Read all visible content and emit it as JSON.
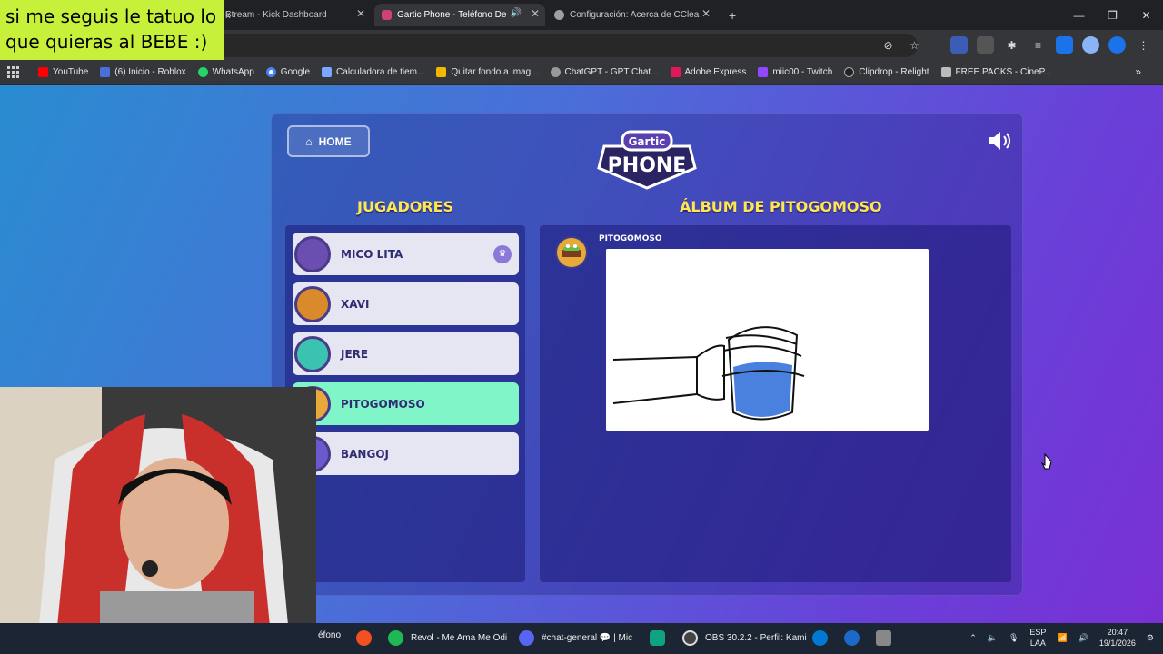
{
  "overlay": {
    "text": "si me seguis le tatuo lo que quieras al BEBE :)"
  },
  "browser": {
    "tabs": [
      {
        "title": "Stream - Kick Dashboard",
        "color": "#53fc18"
      },
      {
        "title": "Gartic Phone - Teléfono De",
        "color": "#8e44ff"
      },
      {
        "title": "Configuración: Acerca de CClea",
        "color": "#888888"
      }
    ],
    "omnibox_text": "k",
    "bookmarks": [
      {
        "label": "YouTube",
        "color": "#ff0000"
      },
      {
        "label": "(6) Inicio - Roblox",
        "color": "#4a6fd8"
      },
      {
        "label": "WhatsApp",
        "color": "#25d366"
      },
      {
        "label": "Google",
        "color": "#4285f4"
      },
      {
        "label": "Calculadora de tiem...",
        "color": "#7aa7ff"
      },
      {
        "label": "Quitar fondo a imag...",
        "color": "#f5b800"
      },
      {
        "label": "ChatGPT - GPT Chat...",
        "color": "#999999"
      },
      {
        "label": "Adobe Express",
        "color": "#e0185a"
      },
      {
        "label": "miic00 - Twitch",
        "color": "#9146ff"
      },
      {
        "label": "Clipdrop - Relight",
        "color": "#222222"
      },
      {
        "label": "FREE PACKS - CineP...",
        "color": "#bbbbbb"
      }
    ]
  },
  "game": {
    "home_label": "HOME",
    "players_title": "JUGADORES",
    "album_title": "ÁLBUM DE PITOGOMOSO",
    "players": [
      {
        "name": "MICO LITA",
        "host": true,
        "avatar_color": "#6b4fb0"
      },
      {
        "name": "XAVI",
        "host": false,
        "avatar_color": "#d98a2b"
      },
      {
        "name": "JERE",
        "host": false,
        "avatar_color": "#3cc2b0"
      },
      {
        "name": "PITOGOMOSO",
        "host": false,
        "avatar_color": "#e6a93a"
      },
      {
        "name": "BANGOJ",
        "host": false,
        "avatar_color": "#6a5acd"
      }
    ],
    "album_author": "PITOGOMOSO"
  },
  "taskbar": {
    "items": [
      {
        "label": "éfono",
        "color": "#8e44ff"
      },
      {
        "label": "",
        "color": "#f25022"
      },
      {
        "label": "Revol - Me Ama Me Odi",
        "color": "#1db954"
      },
      {
        "label": "#chat-general 💬 | Mic",
        "color": "#5865f2"
      },
      {
        "label": "",
        "color": "#10a37f"
      },
      {
        "label": "OBS 30.2.2 - Perfil: Kami",
        "color": "#444444"
      },
      {
        "label": "",
        "color": "#0078d4"
      },
      {
        "label": "",
        "color": "#1b6ac9"
      },
      {
        "label": "",
        "color": "#888888"
      }
    ],
    "lang": "ESP",
    "lang2": "LAA",
    "time": "20:47",
    "date": "19/1/2026"
  }
}
